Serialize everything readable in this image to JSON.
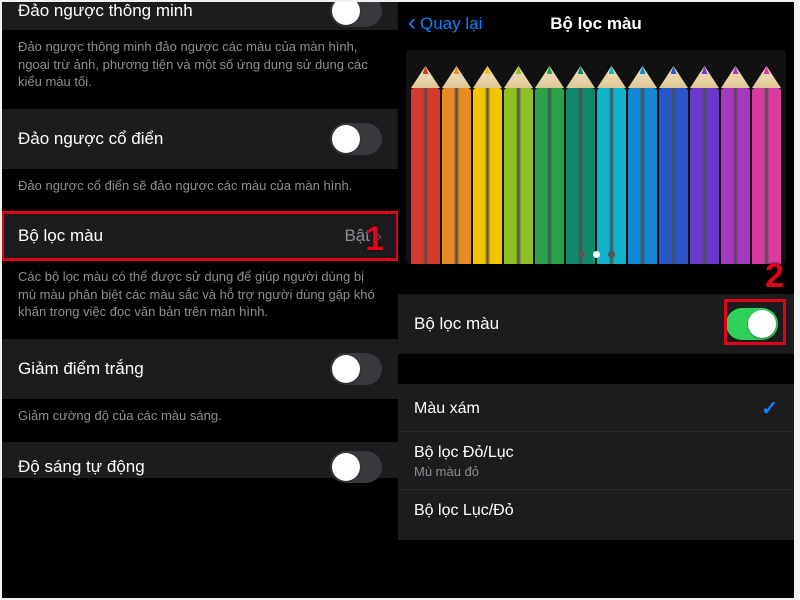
{
  "left": {
    "smart_invert": {
      "label": "Đảo ngược thông minh"
    },
    "smart_invert_desc": "Đảo ngược thông minh đảo ngược các màu của màn hình, ngoại trừ ảnh, phương tiện và một số ứng dụng sử dụng các kiểu màu tối.",
    "classic_invert": {
      "label": "Đảo ngược cổ điển"
    },
    "classic_invert_desc": "Đảo ngược cổ điển sẽ đảo ngược các màu của màn hình.",
    "color_filters": {
      "label": "Bộ lọc màu",
      "value": "Bật"
    },
    "color_filters_desc": "Các bộ lọc màu có thể được sử dụng để giúp người dùng bị mù màu phân biệt các màu sắc và hỗ trợ người dùng gặp khó khăn trong việc đọc văn bản trên màn hình.",
    "reduce_white": {
      "label": "Giảm điểm trắng"
    },
    "reduce_white_desc": "Giảm cường độ của các màu sáng.",
    "auto_bright": {
      "label": "Độ sáng tự động"
    },
    "callout": "1"
  },
  "right": {
    "back": "Quay lại",
    "title": "Bộ lọc màu",
    "pencil_colors": [
      "#d53a2f",
      "#e88a1f",
      "#f3c300",
      "#8fbf22",
      "#2aa24a",
      "#0e8a6a",
      "#12b3c9",
      "#1388d8",
      "#2a56c9",
      "#6a39c9",
      "#a738c0",
      "#d93aa0"
    ],
    "page_index": 1,
    "toggle": {
      "label": "Bộ lọc màu",
      "on": true
    },
    "filters": {
      "gray": {
        "label": "Màu xám",
        "selected": true
      },
      "red_green": {
        "label": "Bộ lọc Đỏ/Lục",
        "sub": "Mù màu đỏ"
      },
      "green_red": {
        "label": "Bộ lọc Lục/Đỏ"
      }
    },
    "callout": "2"
  }
}
